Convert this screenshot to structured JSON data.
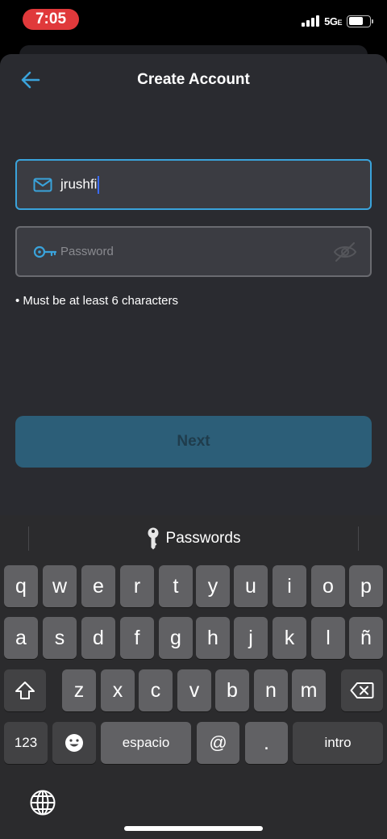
{
  "status_bar": {
    "time": "7:05",
    "network": "5G",
    "network_suffix": "E"
  },
  "header": {
    "title": "Create Account",
    "back_icon": "arrow-left-icon"
  },
  "form": {
    "email": {
      "value": "jrushfi",
      "icon": "mail-icon"
    },
    "password": {
      "placeholder": "Password",
      "icon": "key-icon",
      "toggle_icon": "eye-off-icon"
    },
    "hint": "• Must be at least 6 characters",
    "next_label": "Next"
  },
  "colors": {
    "accent": "#3aa3db",
    "next_button": "#2c5e78",
    "background": "#2a2b30"
  },
  "keyboard": {
    "suggestion": "Passwords",
    "row1": [
      "q",
      "w",
      "e",
      "r",
      "t",
      "y",
      "u",
      "i",
      "o",
      "p"
    ],
    "row2": [
      "a",
      "s",
      "d",
      "f",
      "g",
      "h",
      "j",
      "k",
      "l",
      "ñ"
    ],
    "row3": [
      "z",
      "x",
      "c",
      "v",
      "b",
      "n",
      "m"
    ],
    "numbers_label": "123",
    "space_label": "espacio",
    "at_label": "@",
    "dot_label": ".",
    "return_label": "intro"
  }
}
